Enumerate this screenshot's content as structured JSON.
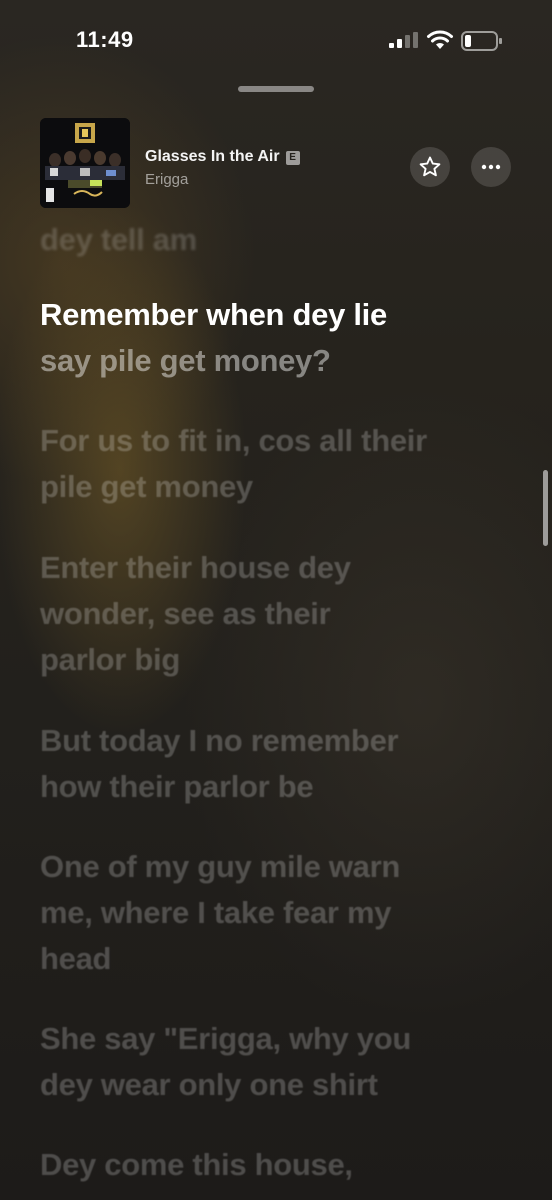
{
  "status_bar": {
    "time": "11:49"
  },
  "now_playing": {
    "title": "Glasses In the Air",
    "explicit": "E",
    "artist": "Erigga"
  },
  "lyrics": [
    {
      "lines": [
        "dey tell am"
      ],
      "state": "previous"
    },
    {
      "lines": [
        "Remember when dey lie",
        "say pile get money?"
      ],
      "state": "active"
    },
    {
      "lines": [
        "For us to fit in, cos all their",
        "pile get money"
      ],
      "state": "upcoming"
    },
    {
      "lines": [
        "Enter their house dey",
        "wonder, see as their",
        "parlor big"
      ],
      "state": "upcoming"
    },
    {
      "lines": [
        "But today I no remember",
        "how their parlor be"
      ],
      "state": "upcoming"
    },
    {
      "lines": [
        "One of my guy mile warn",
        "me, where I take fear my",
        "head"
      ],
      "state": "upcoming"
    },
    {
      "lines": [
        "She say \"Erigga, why you",
        "dey wear only one shirt"
      ],
      "state": "upcoming"
    },
    {
      "lines": [
        "Dey come this house,"
      ],
      "state": "upcoming"
    }
  ],
  "colors": {
    "background": "#22201c",
    "active_lyric": "#ffffff"
  }
}
